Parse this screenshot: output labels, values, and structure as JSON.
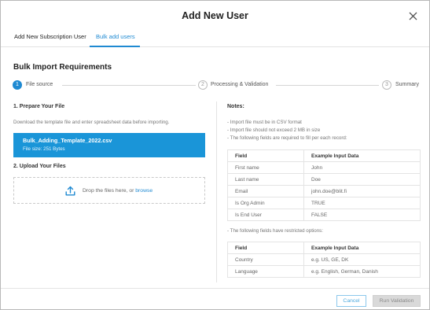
{
  "dialog": {
    "title": "Add New User"
  },
  "tabs": [
    {
      "label": "Add New Subscription User"
    },
    {
      "label": "Bulk add users"
    }
  ],
  "section_title": "Bulk Import Requirements",
  "steps": [
    {
      "number": "1",
      "label": "File source"
    },
    {
      "number": "2",
      "label": "Processing & Validation"
    },
    {
      "number": "3",
      "label": "Summary"
    }
  ],
  "prepare": {
    "heading": "1. Prepare Your File",
    "description": "Download the template file and enter spreadsheet data before importing.",
    "file_name": "Bulk_Adding_Template_2022.csv",
    "file_size": "File size: 251 Bytes"
  },
  "upload": {
    "heading": "2. Upload Your Files",
    "drop_text": "Drop the files here, or ",
    "browse_link": "browse"
  },
  "notes": {
    "heading": "Notes:",
    "lines": [
      "- Import file must be in CSV format",
      "- Import file should not exceed 2 MB in size",
      "- The following fields are required to fill per each record:"
    ],
    "required_table": {
      "headers": [
        "Field",
        "Example Input Data"
      ],
      "rows": [
        [
          "First name",
          "John"
        ],
        [
          "Last name",
          "Doe"
        ],
        [
          "Email",
          "john.doe@blit.fi"
        ],
        [
          "Is Org Admin",
          "TRUE"
        ],
        [
          "Is End User",
          "FALSE"
        ]
      ]
    },
    "restricted_line": "- The following fields have restricted options:",
    "restricted_table": {
      "headers": [
        "Field",
        "Example Input Data"
      ],
      "rows": [
        [
          "Country",
          "e.g. US, GE, DK"
        ],
        [
          "Language",
          "e.g. English, German, Danish"
        ]
      ]
    }
  },
  "footer": {
    "cancel_label": "Cancel",
    "run_label": "Run Validation"
  },
  "colors": {
    "accent": "#1f8ad2",
    "file_card": "#1a95d8",
    "disabled_button": "#d9d9d9"
  },
  "icons": {
    "close": "close-icon",
    "upload": "upload-icon"
  }
}
